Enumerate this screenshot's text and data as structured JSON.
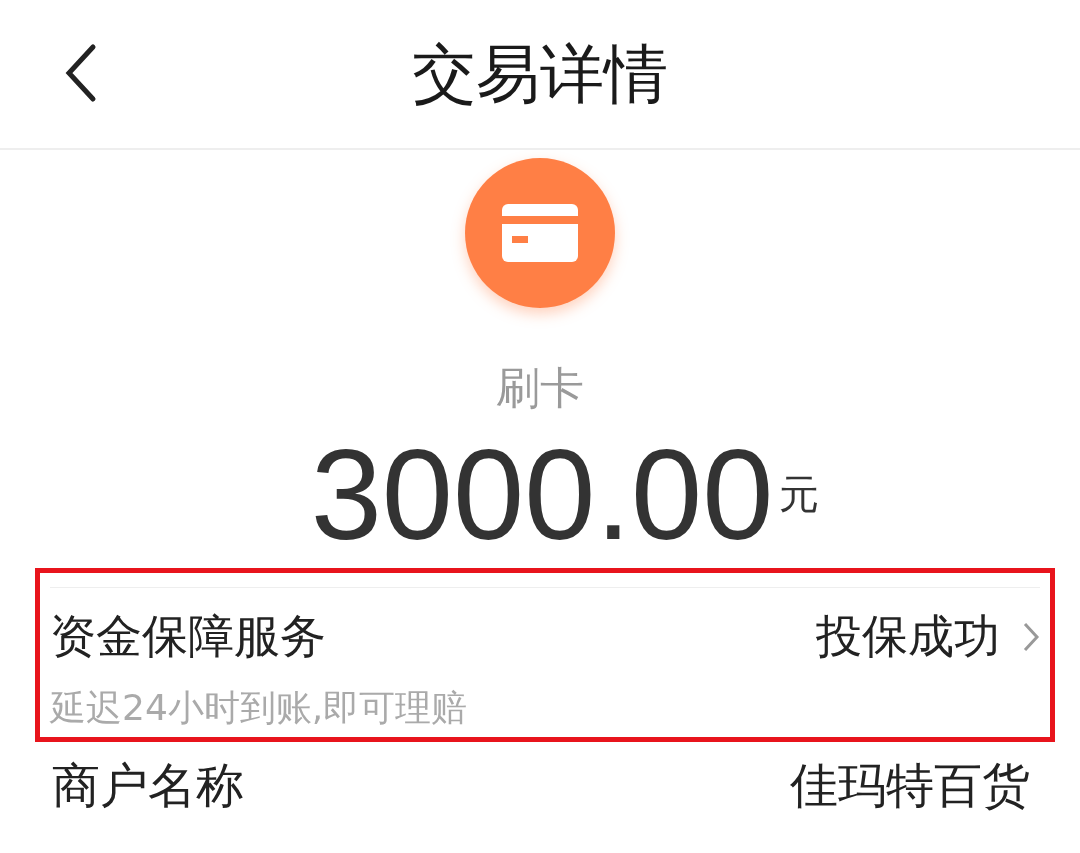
{
  "header": {
    "title": "交易详情"
  },
  "payment": {
    "method": "刷卡",
    "amount": "3000.00",
    "unit": "元"
  },
  "protection": {
    "title": "资金保障服务",
    "status": "投保成功",
    "note": "延迟24小时到账,即可理赔",
    "highlighted": true
  },
  "merchant": {
    "label": "商户名称",
    "value": "佳玛特百货"
  }
}
